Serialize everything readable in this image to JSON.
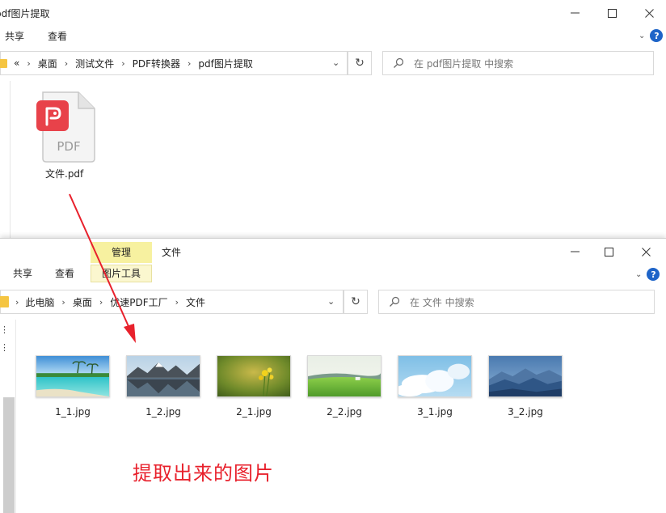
{
  "window_back": {
    "title": "pdf图片提取",
    "ribbon_tabs": [
      "共享",
      "查看"
    ],
    "breadcrumb": [
      "«",
      "桌面",
      "测试文件",
      "PDF转换器",
      "pdf图片提取"
    ],
    "search_placeholder": "在 pdf图片提取 中搜索",
    "file": {
      "name": "文件.pdf",
      "icon": "pdf-file-icon",
      "badge_text": "PDF"
    }
  },
  "window_front": {
    "context_tab": "管理",
    "context_subtab": "图片工具",
    "tab_file": "文件",
    "ribbon_tabs": [
      "共享",
      "查看"
    ],
    "breadcrumb": [
      "此电脑",
      "桌面",
      "优速PDF工厂",
      "文件"
    ],
    "search_placeholder": "在 文件 中搜索",
    "images": [
      {
        "name": "1_1.jpg",
        "scene": "tropical-beach"
      },
      {
        "name": "1_2.jpg",
        "scene": "mountain-lake"
      },
      {
        "name": "2_1.jpg",
        "scene": "yellow-flowers"
      },
      {
        "name": "2_2.jpg",
        "scene": "green-meadow"
      },
      {
        "name": "3_1.jpg",
        "scene": "blue-sky-clouds"
      },
      {
        "name": "3_2.jpg",
        "scene": "blue-mountains"
      }
    ]
  },
  "annotation": {
    "text": "提取出来的图片",
    "color": "#e8212c"
  },
  "colors": {
    "help_blue": "#1e64c8",
    "folder_yellow": "#f5c542",
    "pdf_red": "#e8424a",
    "context_tab": "#f7f1a0"
  }
}
